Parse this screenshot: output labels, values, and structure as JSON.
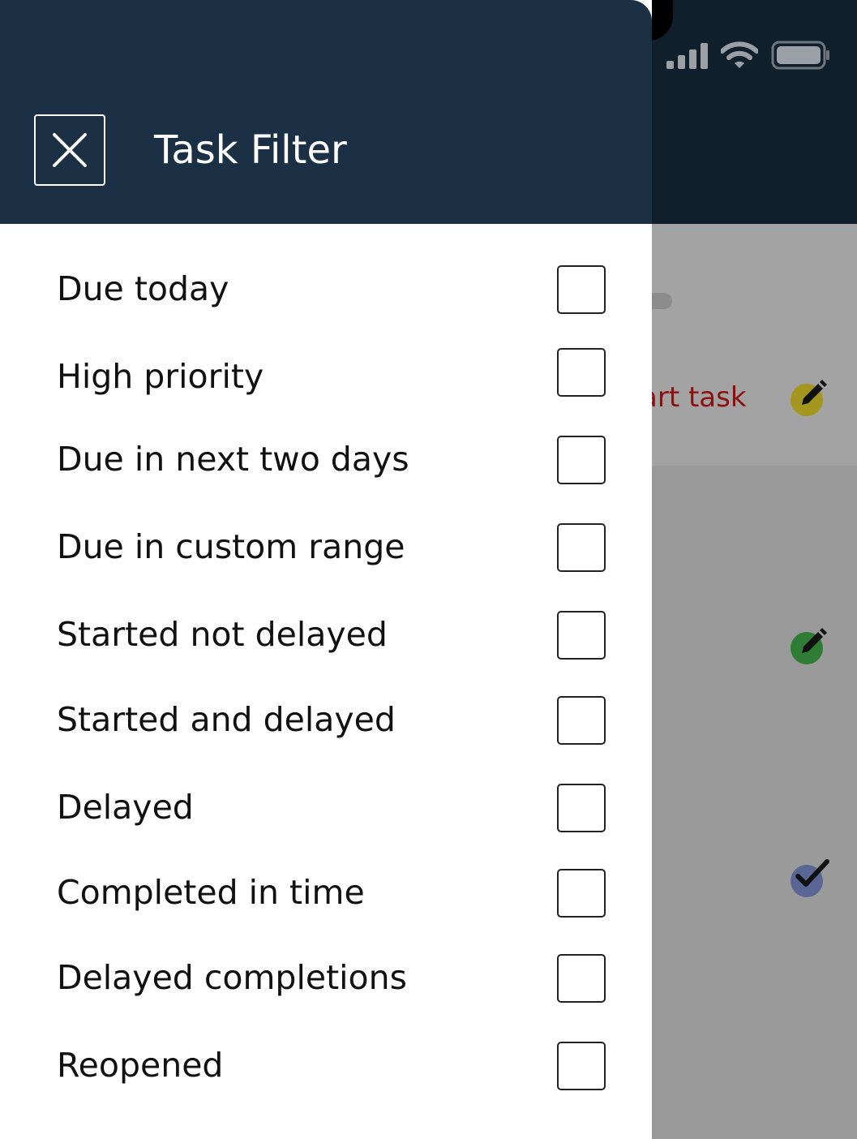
{
  "drawer": {
    "title": "Task Filter",
    "close_icon": "close-icon",
    "filters": [
      {
        "label": "Due today",
        "checked": false
      },
      {
        "label": "High priority",
        "checked": false
      },
      {
        "label": "Due in next two days",
        "checked": false
      },
      {
        "label": "Due in custom range",
        "checked": false
      },
      {
        "label": "Started not delayed",
        "checked": false
      },
      {
        "label": "Started and delayed",
        "checked": false
      },
      {
        "label": "Delayed",
        "checked": false
      },
      {
        "label": "Completed in time",
        "checked": false
      },
      {
        "label": "Delayed completions",
        "checked": false
      },
      {
        "label": "Reopened",
        "checked": false
      }
    ]
  },
  "background": {
    "task_text": "art task",
    "icons": [
      {
        "name": "edit-icon",
        "color": "#a39720"
      },
      {
        "name": "edit-icon",
        "color": "#2f7d34"
      },
      {
        "name": "check-icon",
        "color": "#5a6794"
      }
    ]
  },
  "colors": {
    "header": "#1b3045",
    "status_bar_bg": "#0f1f2b",
    "overlay": "#9a9a9a",
    "task_text": "#8c1010"
  }
}
